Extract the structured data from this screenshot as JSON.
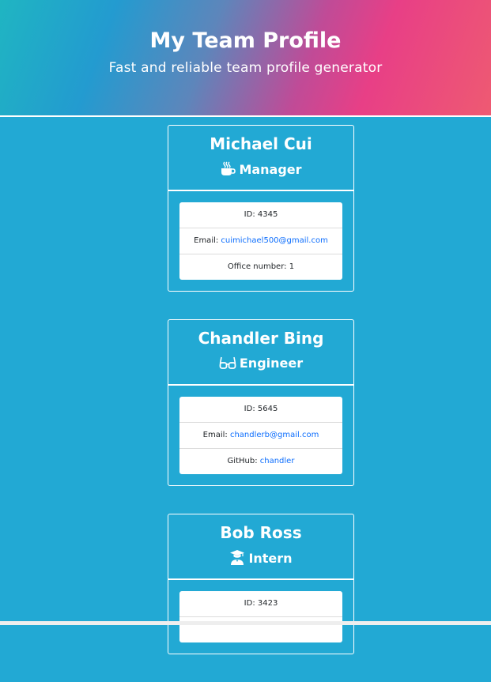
{
  "header": {
    "title": "My Team Profile",
    "subtitle": "Fast and reliable team profile generator"
  },
  "colors": {
    "background": "#22a9d4",
    "link": "#0d6efd"
  },
  "cards": [
    {
      "name": "Michael Cui",
      "role": "Manager",
      "role_icon": "coffee-icon",
      "id_label": "ID: ",
      "id": "4345",
      "email_label": "Email: ",
      "email": "cuimichael500@gmail.com",
      "extra_label": "Office number: ",
      "extra": "1"
    },
    {
      "name": "Chandler Bing",
      "role": "Engineer",
      "role_icon": "glasses-icon",
      "id_label": "ID: ",
      "id": "5645",
      "email_label": "Email: ",
      "email": "chandlerb@gmail.com",
      "extra_label": "GitHub: ",
      "extra": "chandler"
    },
    {
      "name": "Bob Ross",
      "role": "Intern",
      "role_icon": "graduate-icon",
      "id_label": "ID: ",
      "id": "3423"
    }
  ]
}
